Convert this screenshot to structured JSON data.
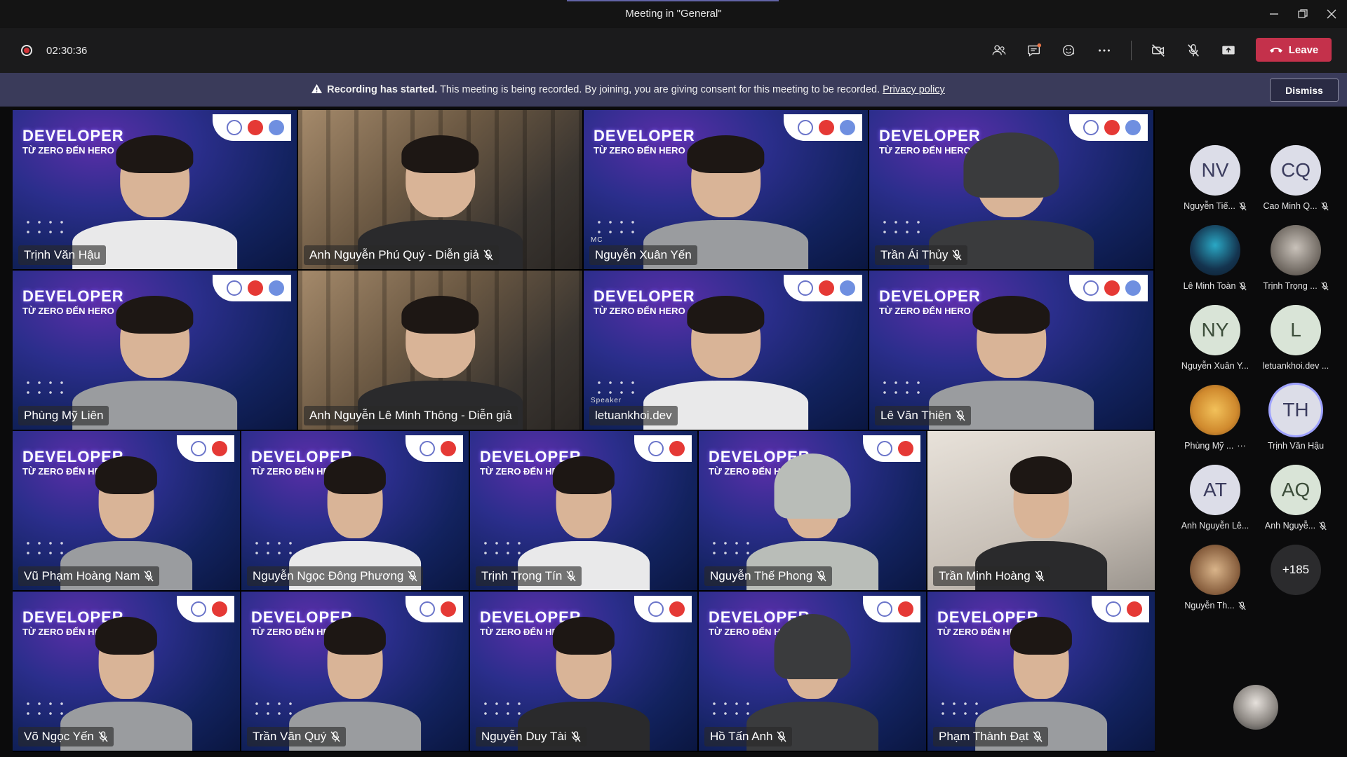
{
  "window": {
    "title": "Meeting in \"General\""
  },
  "meeting": {
    "timer": "02:30:36",
    "leave_label": "Leave"
  },
  "banner": {
    "bold": "Recording has started.",
    "text": " This meeting is being recorded. By joining, you are giving consent for this meeting to be recorded. ",
    "link": "Privacy policy",
    "dismiss_label": "Dismiss"
  },
  "video_banner": {
    "title": "DEVELOPER",
    "subtitle": "TỪ ZERO ĐẾN HERO"
  },
  "tiles": [
    {
      "name": "Trịnh Văn Hậu",
      "muted": false
    },
    {
      "name": "Anh Nguyễn Phú Quý - Diễn giả",
      "muted": true
    },
    {
      "name": "Nguyễn Xuân Yến",
      "muted": false,
      "role": "MC"
    },
    {
      "name": "Trần Ái Thủy",
      "muted": true
    },
    {
      "name": "Phùng Mỹ Liên",
      "muted": false
    },
    {
      "name": "Anh Nguyễn Lê Minh Thông - Diễn giả",
      "muted": false
    },
    {
      "name": "letuankhoi.dev",
      "muted": false,
      "role": "Speaker"
    },
    {
      "name": "Lê Văn Thiện",
      "muted": true
    },
    {
      "name": "Vũ Phạm Hoàng Nam",
      "muted": true
    },
    {
      "name": "Nguyễn Ngọc Đông Phương",
      "muted": true
    },
    {
      "name": "Trịnh Trọng Tín",
      "muted": true
    },
    {
      "name": "Nguyễn Thế Phong",
      "muted": true
    },
    {
      "name": "Trần Minh Hoàng",
      "muted": true
    },
    {
      "name": "Võ Ngọc Yến",
      "muted": true
    },
    {
      "name": "Trần Văn Quý",
      "muted": true
    },
    {
      "name": "Nguyễn Duy Tài",
      "muted": true
    },
    {
      "name": "Hồ Tấn Anh",
      "muted": true
    },
    {
      "name": "Phạm Thành Đạt",
      "muted": true
    }
  ],
  "participants": [
    {
      "initials": "NV",
      "name": "Nguyễn Tiế...",
      "muted": true
    },
    {
      "initials": "CQ",
      "name": "Cao Minh Q...",
      "muted": true
    },
    {
      "initials": "",
      "name": "Lê Minh Toàn",
      "muted": true
    },
    {
      "initials": "",
      "name": "Trịnh Trọng ...",
      "muted": true
    },
    {
      "initials": "NY",
      "name": "Nguyễn Xuân Y...",
      "muted": false
    },
    {
      "initials": "L",
      "name": "letuankhoi.dev ...",
      "muted": false
    },
    {
      "initials": "",
      "name": "Phùng Mỹ ...",
      "muted": false,
      "more": "···"
    },
    {
      "initials": "TH",
      "name": "Trịnh Văn Hậu",
      "muted": false
    },
    {
      "initials": "AT",
      "name": "Anh Nguyễn Lê...",
      "muted": false
    },
    {
      "initials": "AQ",
      "name": "Anh Nguyễ...",
      "muted": true
    },
    {
      "initials": "",
      "name": "Nguyễn Th...",
      "muted": true
    },
    {
      "initials": "+185",
      "name": "",
      "muted": false
    }
  ],
  "icons": {
    "record": "record-icon",
    "people": "people-icon",
    "chat": "chat-icon",
    "reactions": "reactions-icon",
    "more": "more-icon",
    "camera_off": "camera-off-icon",
    "mic_off": "mic-off-icon",
    "share": "share-icon",
    "phone": "phone-icon",
    "warning": "warning-icon"
  },
  "colors": {
    "leave": "#c4314b",
    "banner": "#3a3b5a",
    "accent": "#6264a7"
  }
}
